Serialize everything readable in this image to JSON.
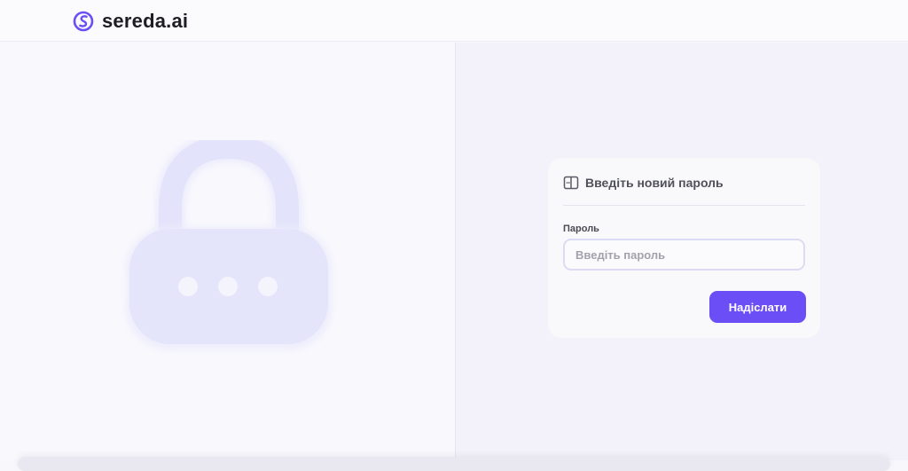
{
  "header": {
    "brand_name": "sereda.ai",
    "logo_icon": "sereda-logo-icon",
    "accent_color": "#6b4ef6"
  },
  "illustration": {
    "icon": "padlock-icon",
    "color": "#e4e4fb"
  },
  "form": {
    "title": "Введіть новий пароль",
    "title_icon": "book-icon",
    "password_label": "Пароль",
    "password_value": "",
    "password_placeholder": "Введіть пароль",
    "submit_label": "Надіслати",
    "submit_color": "#6b4ef6"
  }
}
